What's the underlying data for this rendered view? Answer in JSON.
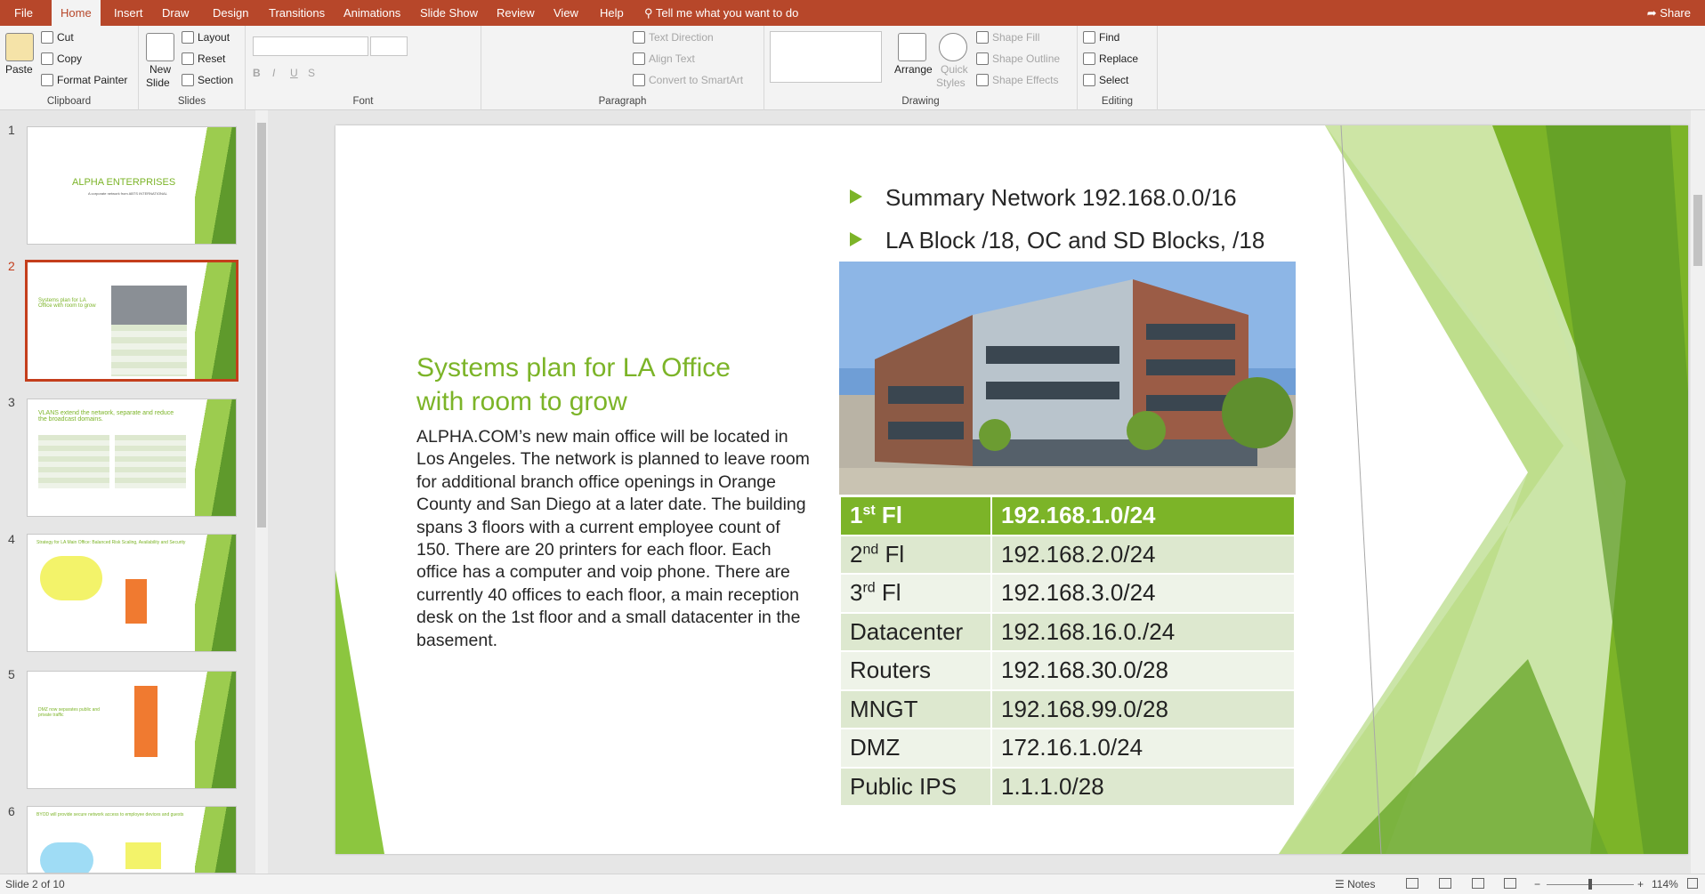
{
  "tabs": [
    "File",
    "Home",
    "Insert",
    "Draw",
    "Design",
    "Transitions",
    "Animations",
    "Slide Show",
    "Review",
    "View",
    "Help"
  ],
  "tell_me": "Tell me what you want to do",
  "share": "Share",
  "ribbon": {
    "clipboard": {
      "paste": "Paste",
      "cut": "Cut",
      "copy": "Copy",
      "format_painter": "Format Painter",
      "label": "Clipboard"
    },
    "slides": {
      "new_slide_1": "New",
      "new_slide_2": "Slide",
      "layout": "Layout",
      "reset": "Reset",
      "section": "Section",
      "label": "Slides"
    },
    "font": {
      "label": "Font"
    },
    "paragraph": {
      "text_direction": "Text Direction",
      "align_text": "Align Text",
      "convert_smartart": "Convert to SmartArt",
      "label": "Paragraph"
    },
    "drawing": {
      "arrange": "Arrange",
      "quick_styles_1": "Quick",
      "quick_styles_2": "Styles",
      "shape_fill": "Shape Fill",
      "shape_outline": "Shape Outline",
      "shape_effects": "Shape Effects",
      "label": "Drawing"
    },
    "editing": {
      "find": "Find",
      "replace": "Replace",
      "select": "Select",
      "label": "Editing"
    }
  },
  "thumbnails": [
    {
      "num": "1",
      "title": "ALPHA ENTERPRISES",
      "sub": "A corporate network from ABTS INTERNATIONAL"
    },
    {
      "num": "2",
      "title": "Systems plan for LA Office with room to grow"
    },
    {
      "num": "3",
      "title": "VLANS extend the network, separate and reduce the broadcast domains."
    },
    {
      "num": "4",
      "title": "Strategy for LA Main Office: Balanced Risk Scaling, Availability and Security"
    },
    {
      "num": "5",
      "title": "DMZ now separates public and private traffic"
    },
    {
      "num": "6",
      "title": "BYOD will provide secure network access to employee devices and guests"
    }
  ],
  "slide": {
    "bullets": [
      "Summary Network 192.168.0.0/16",
      "LA Block /18, OC and SD Blocks, /18"
    ],
    "title": "Systems plan for LA Office with room to grow",
    "body": "ALPHA.COM’s new main office will be located in Los Angeles. The network is planned to leave room for additional branch office openings in Orange County and San Diego at a later date. The building spans 3 floors with a current employee count of 150. There are 20 printers for each floor. Each office has a computer and voip phone. There are currently 40 offices to each floor, a main reception desk on the 1st floor and a small datacenter in the basement.",
    "table": [
      {
        "name": "1st Fl",
        "base": "1",
        "sup": "st",
        "rest": " Fl",
        "net": "192.168.1.0/24"
      },
      {
        "base": "2",
        "sup": "nd",
        "rest": " Fl",
        "net": "192.168.2.0/24"
      },
      {
        "base": "3",
        "sup": "rd",
        "rest": " Fl",
        "net": "192.168.3.0/24"
      },
      {
        "base": "Datacenter",
        "sup": "",
        "rest": "",
        "net": "192.168.16.0./24"
      },
      {
        "base": "Routers",
        "sup": "",
        "rest": "",
        "net": "192.168.30.0/28"
      },
      {
        "base": "MNGT",
        "sup": "",
        "rest": "",
        "net": "192.168.99.0/28"
      },
      {
        "base": "DMZ",
        "sup": "",
        "rest": "",
        "net": "172.16.1.0/24"
      },
      {
        "base": "Public IPS",
        "sup": "",
        "rest": "",
        "net": "1.1.1.0/28"
      }
    ]
  },
  "status": {
    "slide_of": "Slide 2 of 10",
    "notes": "Notes",
    "zoom": "114%"
  },
  "colors": {
    "accent": "#b7472a",
    "green": "#7cb428"
  }
}
